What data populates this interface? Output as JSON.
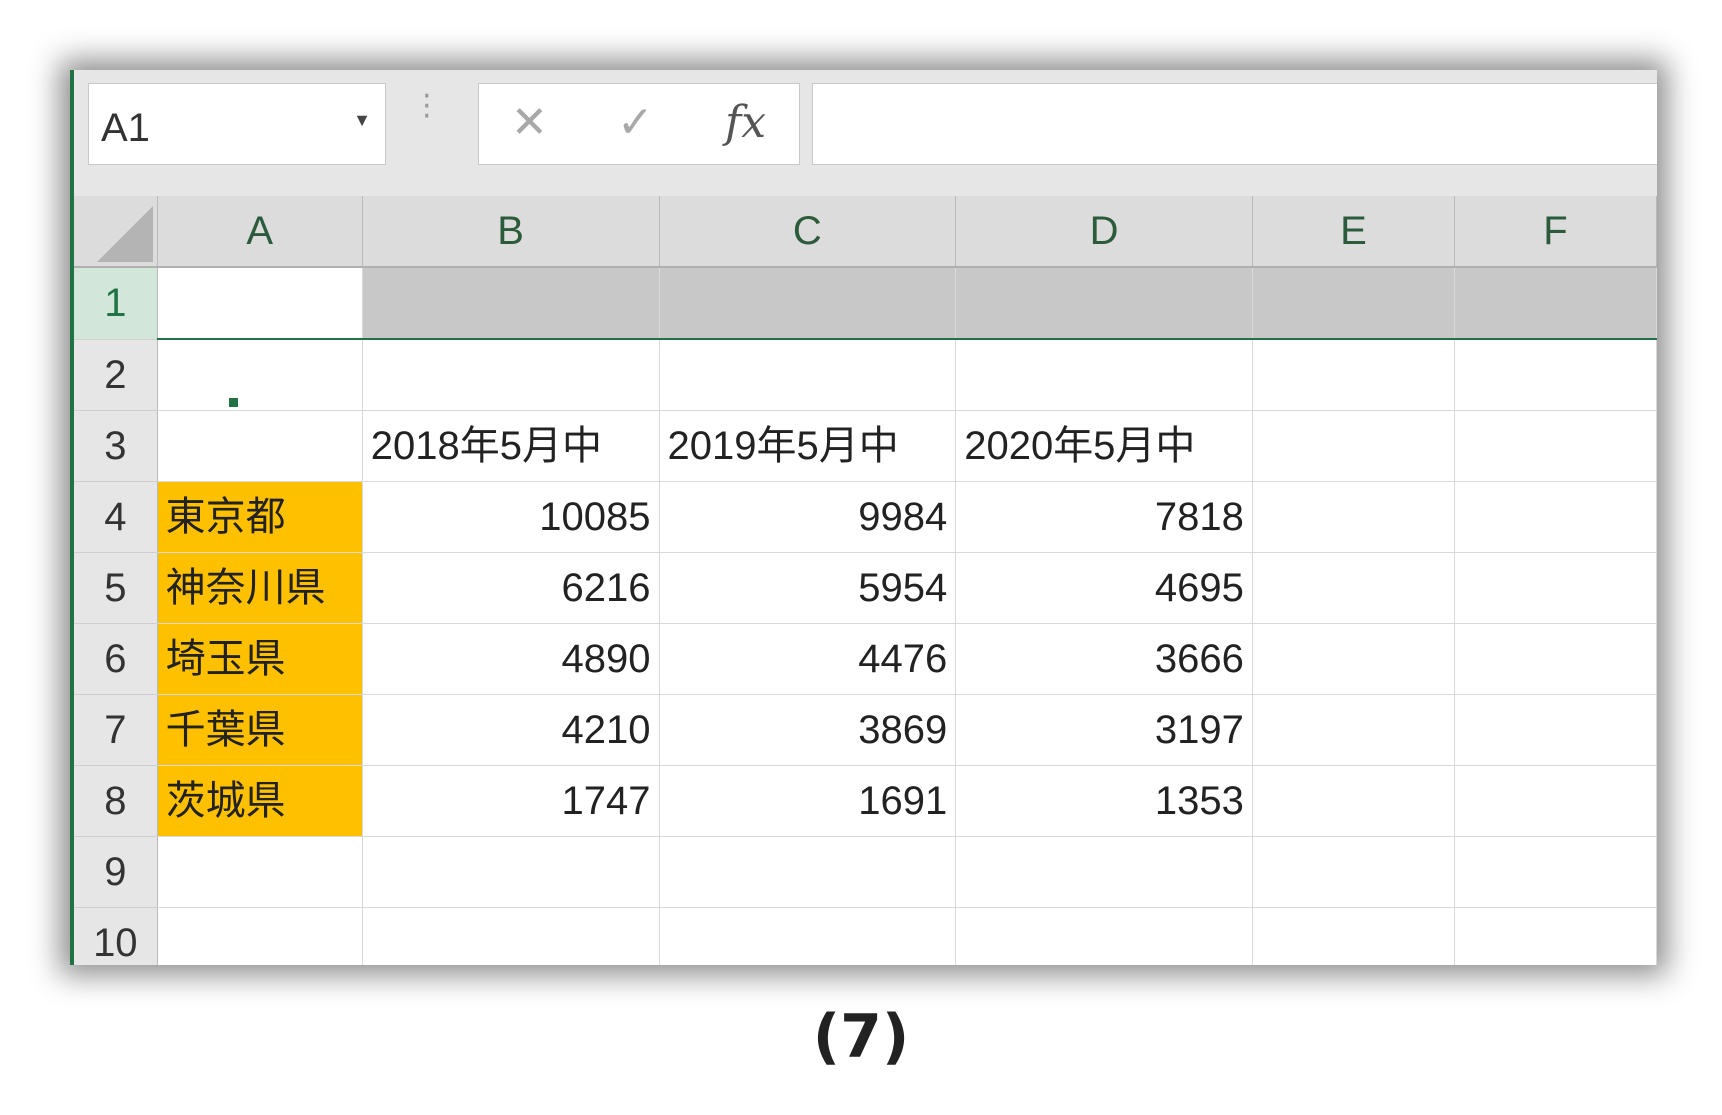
{
  "formula_bar": {
    "name_box": "A1",
    "cancel_icon": "✕",
    "enter_icon": "✓",
    "fx_label": "fx",
    "formula_value": ""
  },
  "columns": [
    "A",
    "B",
    "C",
    "D",
    "E",
    "F"
  ],
  "rows": [
    {
      "num": "1",
      "cells": [
        "",
        "",
        "",
        "",
        "",
        ""
      ]
    },
    {
      "num": "2",
      "cells": [
        "",
        "",
        "",
        "",
        "",
        ""
      ]
    },
    {
      "num": "3",
      "cells": [
        "",
        "2018年5月中",
        "2019年5月中",
        "2020年5月中",
        "",
        ""
      ]
    },
    {
      "num": "4",
      "cells": [
        "東京都",
        "10085",
        "9984",
        "7818",
        "",
        ""
      ]
    },
    {
      "num": "5",
      "cells": [
        "神奈川県",
        "6216",
        "5954",
        "4695",
        "",
        ""
      ]
    },
    {
      "num": "6",
      "cells": [
        "埼玉県",
        "4890",
        "4476",
        "3666",
        "",
        ""
      ]
    },
    {
      "num": "7",
      "cells": [
        "千葉県",
        "4210",
        "3869",
        "3197",
        "",
        ""
      ]
    },
    {
      "num": "8",
      "cells": [
        "茨城県",
        "1747",
        "1691",
        "1353",
        "",
        ""
      ]
    },
    {
      "num": "9",
      "cells": [
        "",
        "",
        "",
        "",
        "",
        ""
      ]
    },
    {
      "num": "10",
      "cells": [
        "",
        "",
        "",
        "",
        "",
        ""
      ]
    }
  ],
  "colors": {
    "accent": "#217346",
    "highlight_fill": "#ffc000",
    "row_selection": "#c8c8c8"
  },
  "selection": {
    "active_cell": "A1",
    "selected_row": "1"
  },
  "caption": "(7)"
}
